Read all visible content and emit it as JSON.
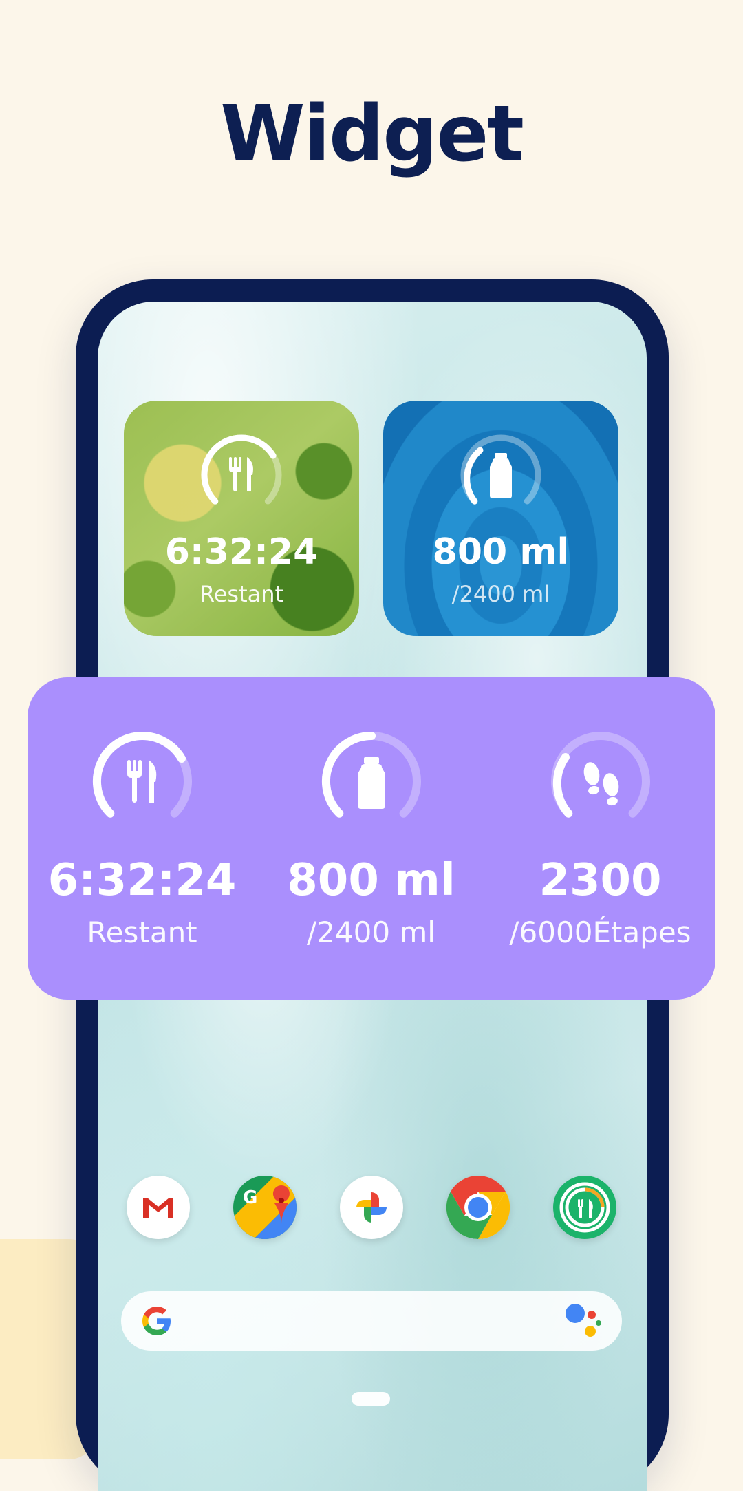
{
  "page": {
    "title": "Widget"
  },
  "small_widgets": {
    "fasting": {
      "value": "6:32:24",
      "label": "Restant",
      "icon": "cutlery-icon",
      "progress": 0.55
    },
    "water": {
      "value": "800 ml",
      "label": "/2400 ml",
      "icon": "bottle-icon",
      "progress": 0.33
    }
  },
  "large_widget": {
    "background": "#aa8ffd",
    "fasting": {
      "value": "6:32:24",
      "label": "Restant",
      "icon": "cutlery-icon",
      "progress": 0.55
    },
    "water": {
      "value": "800 ml",
      "label": "/2400 ml",
      "icon": "bottle-icon",
      "progress": 0.33
    },
    "steps": {
      "value": "2300",
      "label": "/6000Étapes",
      "icon": "footprints-icon",
      "progress": 0.38
    }
  },
  "dock_apps": [
    "gmail-icon",
    "maps-icon",
    "photos-icon",
    "chrome-icon",
    "fasting-app-icon"
  ],
  "search_bar": {
    "left_icon": "google-g-icon",
    "right_icon": "assistant-icon"
  }
}
